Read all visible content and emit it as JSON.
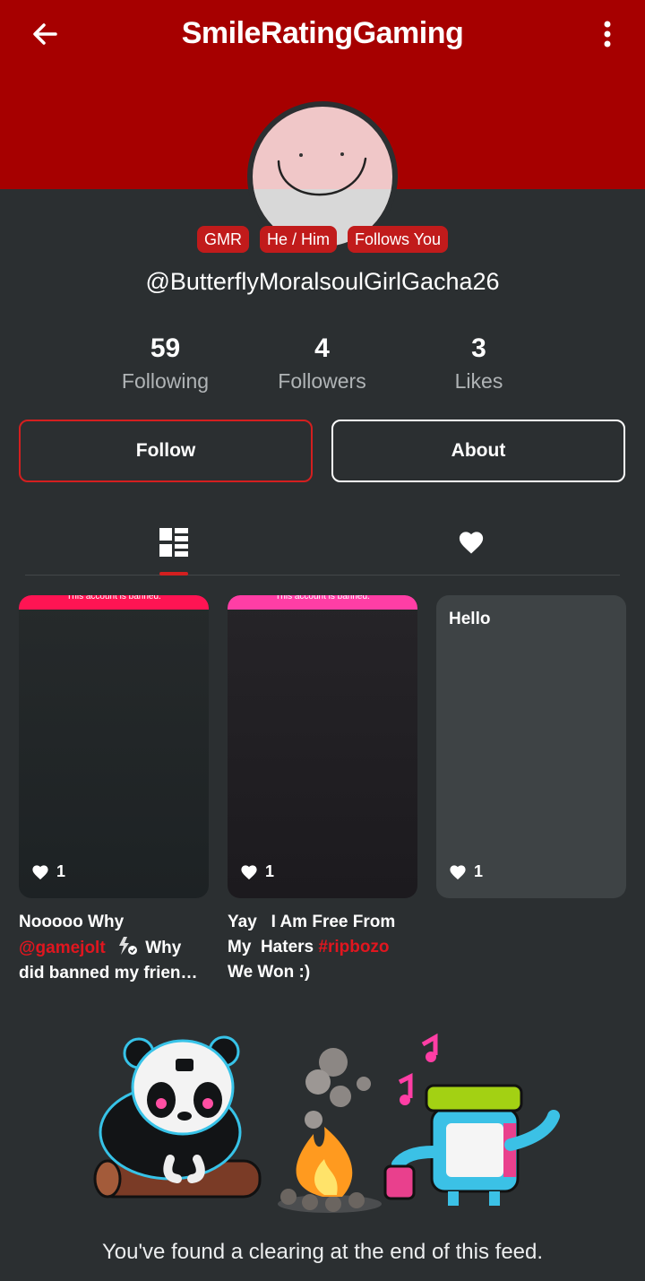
{
  "header": {
    "title": "SmileRatingGaming",
    "back_icon": "arrow-left-icon",
    "menu_icon": "more-vertical-icon",
    "color": "#a60000"
  },
  "profile": {
    "badges": [
      "GMR",
      "He / Him",
      "Follows You"
    ],
    "username": "@ButterflyMoralsoulGirlGacha26"
  },
  "stats": [
    {
      "value": "59",
      "label": "Following"
    },
    {
      "value": "4",
      "label": "Followers"
    },
    {
      "value": "3",
      "label": "Likes"
    }
  ],
  "buttons": {
    "follow": "Follow",
    "about": "About"
  },
  "tabs": {
    "posts_icon": "grid-layout-icon",
    "likes_icon": "heart-icon",
    "active": "posts"
  },
  "posts": [
    {
      "banner": "This account is banned.",
      "likes": "1",
      "caption_line1": "Nooooo Why",
      "mention": "@gamejolt",
      "caption_line2_rest": "Why",
      "caption_line3": "did banned my frien…"
    },
    {
      "banner": "This account is banned.",
      "likes": "1",
      "caption_line1": "Yay   I Am Free From",
      "caption_line2": "My  Haters ",
      "hashtag": "#ripbozo",
      "caption_line3": "We Won :)"
    },
    {
      "text": "Hello",
      "likes": "1"
    }
  ],
  "feed_end": {
    "message": "You've found a clearing at the end of this feed."
  },
  "colors": {
    "accent": "#d41f1f",
    "background": "#2b2f31",
    "badge": "#c11b1b"
  }
}
